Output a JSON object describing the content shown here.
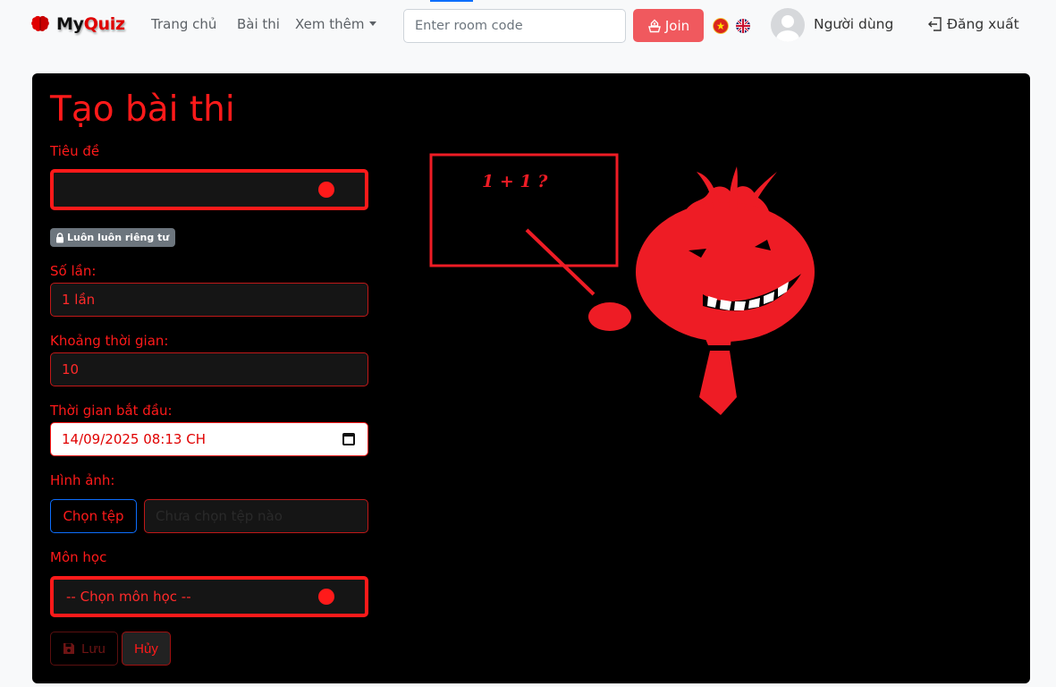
{
  "navbar": {
    "brand_my": "My",
    "brand_quiz": "Quiz",
    "links": [
      "Trang chủ",
      "Bài thi",
      "Xem thêm"
    ],
    "room_placeholder": "Enter room code",
    "join_label": "Join",
    "user_name": "Người dùng",
    "logout_label": "Đăng xuất"
  },
  "form": {
    "title": "Tạo bài thi",
    "title_label": "Tiêu đề",
    "title_value": "",
    "privacy_badge": "Luôn luôn riêng tư",
    "attempts_label": "Số lần:",
    "attempts_value": "1 lần",
    "duration_label": "Khoảng thời gian:",
    "duration_value": "10",
    "start_label": "Thời gian bắt đầu:",
    "start_value": "14/09/2025 08:13 CH",
    "image_label": "Hình ảnh:",
    "choose_file_label": "Chọn tệp",
    "no_file_text": "Chưa chọn tệp nào",
    "subject_label": "Môn học",
    "subject_value": "-- Chọn môn học --",
    "save_label": "Lưu",
    "cancel_label": "Hủy"
  },
  "illustration": {
    "board_text": "1 + 1 ?"
  },
  "colors": {
    "accent": "#ff1a1a",
    "card_bg": "#000000",
    "join_bg": "#f0595e",
    "navbar_bg": "#f8f9fa"
  }
}
